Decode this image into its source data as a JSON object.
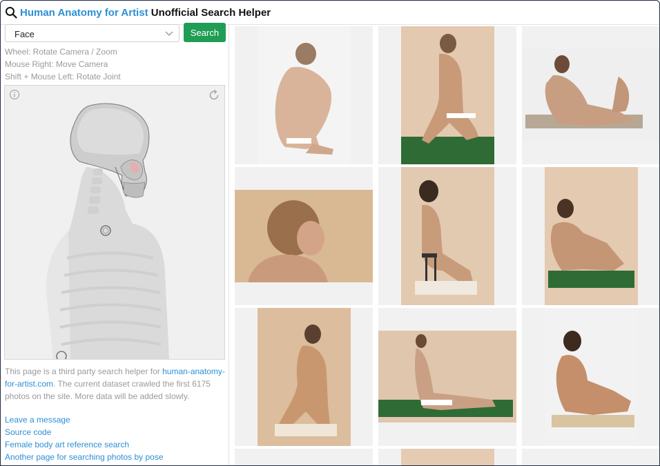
{
  "header": {
    "brand": "Human Anatomy for Artist",
    "title_rest": " Unofficial Search Helper",
    "icon": "search-icon"
  },
  "controls": {
    "selected_part": "Face",
    "search_label": "Search"
  },
  "hints": [
    "Wheel: Rotate Camera / Zoom",
    "Mouse Right: Move Camera",
    "Shift + Mouse Left: Rotate Joint"
  ],
  "viewer": {
    "info_icon": "info-icon",
    "reset_icon": "rotate-reset-icon"
  },
  "about": {
    "prefix": "This page is a third party search helper for ",
    "site_link": "human-anatomy-for-artist.com",
    "suffix": ". The current dataset crawled the first 6175 photos on the site. More data will be added slowly."
  },
  "links": [
    "Leave a message",
    "Source code",
    "Female body art reference search",
    "Another page for searching photos by pose"
  ],
  "results": [
    {
      "pose": "crouching-side",
      "bg": "#f4f4f4"
    },
    {
      "pose": "kneeling-back",
      "bg": "#e3c9b0"
    },
    {
      "pose": "seated-leaning-back",
      "bg": "#efefef"
    },
    {
      "pose": "head-from-behind",
      "bg": "#d9b994"
    },
    {
      "pose": "seated-on-stool",
      "bg": "#e2cab1"
    },
    {
      "pose": "seated-on-board",
      "bg": "#e4cab0"
    },
    {
      "pose": "kneeling-back-hands-on-hips",
      "bg": "#dcbd9d"
    },
    {
      "pose": "v-sit-on-board",
      "bg": "#e0c6ad"
    },
    {
      "pose": "seated-knees-up",
      "bg": "#f2f2f2"
    },
    {
      "pose": "partial-row",
      "bg": "#f1f1f1"
    },
    {
      "pose": "partial-row",
      "bg": "#e4cbb2"
    },
    {
      "pose": "partial-row",
      "bg": "#f1f1f1"
    }
  ]
}
